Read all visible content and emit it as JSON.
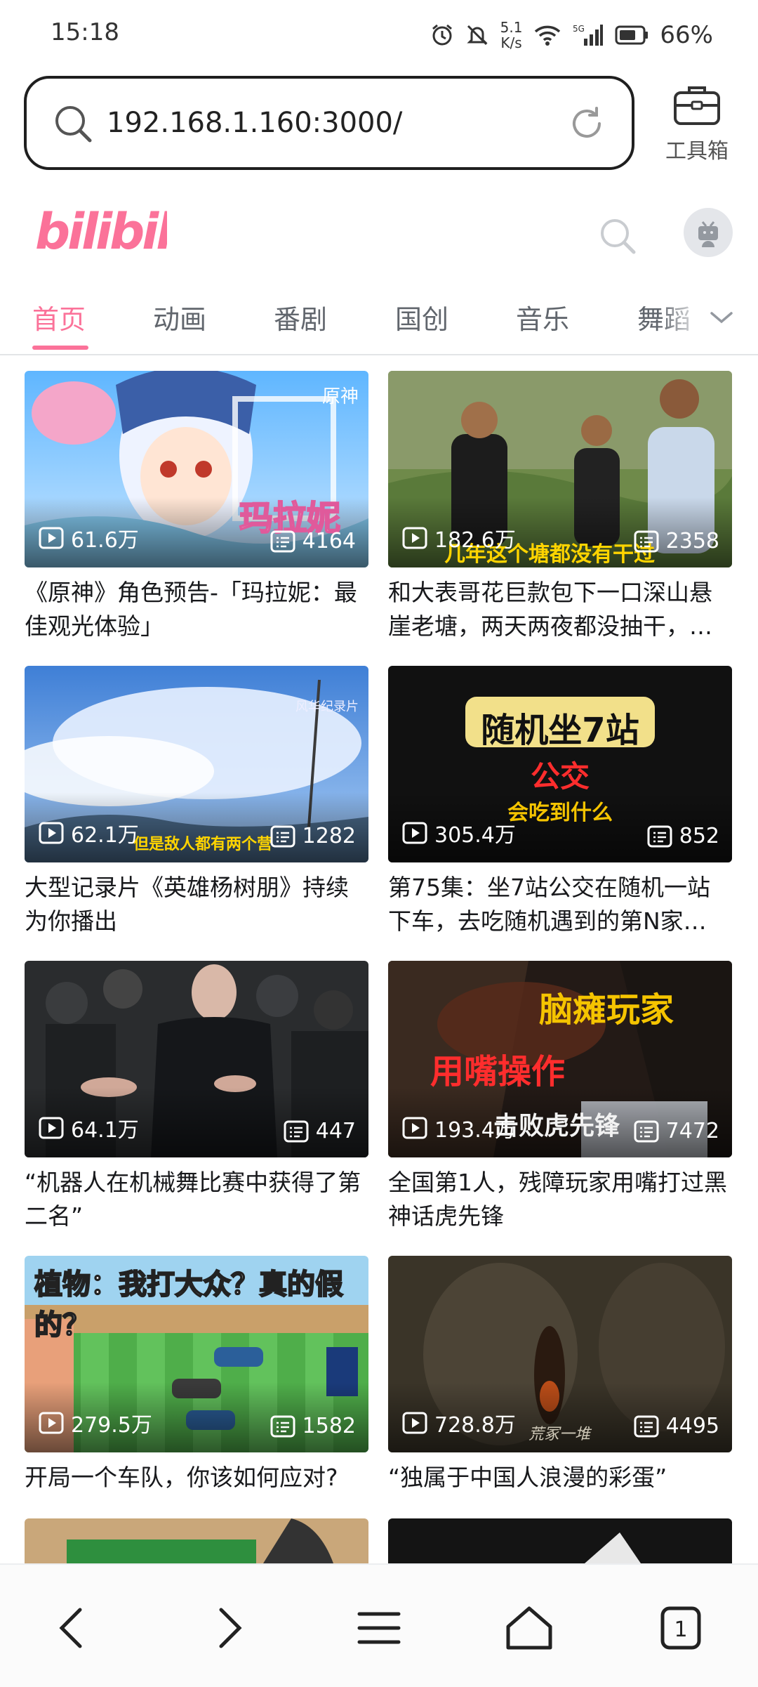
{
  "status_bar": {
    "time": "15:18",
    "speed_value": "5.1",
    "speed_unit": "K/s",
    "network": "5G",
    "battery": "66%"
  },
  "browser": {
    "url": "192.168.1.160:3000/",
    "toolbox_label": "工具箱"
  },
  "site": {
    "logo_text": "bilibili"
  },
  "tabs": [
    "首页",
    "动画",
    "番剧",
    "国创",
    "音乐",
    "舞蹈"
  ],
  "videos": [
    {
      "views": "61.6万",
      "danmaku": "4164",
      "title": "《原神》角色预告-「玛拉妮：最佳观光体验」",
      "overlay": "玛拉妮",
      "corner": "原神"
    },
    {
      "views": "182.6万",
      "danmaku": "2358",
      "title": "和大表哥花巨款包下一口深山悬崖老塘，两天两夜都没抽干，…",
      "overlay": "几年这个塘都没有干过"
    },
    {
      "views": "62.1万",
      "danmaku": "1282",
      "title": "大型记录片《英雄杨树朋》持续为你播出",
      "overlay": "但是敌人都有两个营",
      "corner": "风华纪录片"
    },
    {
      "views": "305.4万",
      "danmaku": "852",
      "title": "第75集：坐7站公交在随机一站下车，去吃随机遇到的第N家…",
      "overlay_line1": "随机坐7站",
      "overlay_line2": "公交",
      "overlay_line3": "会吃到什么"
    },
    {
      "views": "64.1万",
      "danmaku": "447",
      "title": "“机器人在机械舞比赛中获得了第二名”"
    },
    {
      "views": "193.4万",
      "danmaku": "7472",
      "title": "全国第1人，残障玩家用嘴打过黑神话虎先锋",
      "overlay_line1": "脑瘫玩家",
      "overlay_line2": "用嘴操作",
      "overlay_line3": "击败虎先锋"
    },
    {
      "views": "279.5万",
      "danmaku": "1582",
      "title": "开局一个车队，你该如何应对?",
      "overlay": "植物：我打大众？真的假的？"
    },
    {
      "views": "728.8万",
      "danmaku": "4495",
      "title": "“独属于中国人浪漫的彩蛋”",
      "overlay": "荒冢一堆"
    }
  ],
  "colors": {
    "brand_pink": "#fb7299",
    "tab_gray": "#61666d",
    "text": "#18191c"
  },
  "icons": {
    "back": "chevron-left-icon",
    "forward": "chevron-right-icon",
    "menu": "menu-icon",
    "home": "home-icon",
    "tabs": "tabs-icon"
  },
  "browser_tab_count": "1"
}
